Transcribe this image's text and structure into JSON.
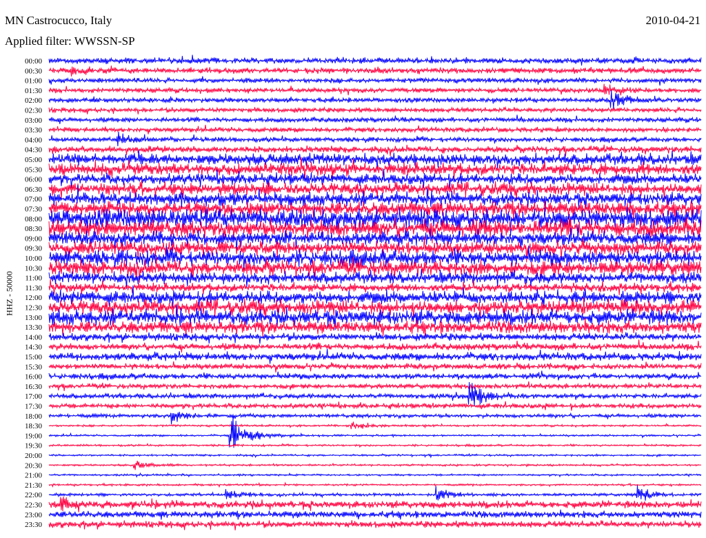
{
  "header": {
    "station": "MN Castrocucco, Italy",
    "date": "2010-04-21",
    "filter": "Applied filter: WWSSN-SP"
  },
  "chart_data": {
    "type": "line",
    "subtype": "helicorder",
    "title": "MN Castrocucco, Italy",
    "ylabel": "HHZ - 50000",
    "xlabel": "",
    "minutes_per_line": 30,
    "colors": [
      "#0000ff",
      "#ff0040"
    ],
    "rows": [
      {
        "t": "00:00",
        "noise": 0.6
      },
      {
        "t": "00:30",
        "noise": 0.6
      },
      {
        "t": "01:00",
        "noise": 0.5
      },
      {
        "t": "01:30",
        "noise": 0.5
      },
      {
        "t": "02:00",
        "noise": 0.5
      },
      {
        "t": "02:30",
        "noise": 0.5
      },
      {
        "t": "03:00",
        "noise": 0.5
      },
      {
        "t": "03:30",
        "noise": 0.5
      },
      {
        "t": "04:00",
        "noise": 0.5
      },
      {
        "t": "04:30",
        "noise": 0.7
      },
      {
        "t": "05:00",
        "noise": 1.2
      },
      {
        "t": "05:30",
        "noise": 1.3
      },
      {
        "t": "06:00",
        "noise": 1.1
      },
      {
        "t": "06:30",
        "noise": 1.3
      },
      {
        "t": "07:00",
        "noise": 1.4
      },
      {
        "t": "07:30",
        "noise": 1.5
      },
      {
        "t": "08:00",
        "noise": 2.0
      },
      {
        "t": "08:30",
        "noise": 1.8
      },
      {
        "t": "09:00",
        "noise": 1.4
      },
      {
        "t": "09:30",
        "noise": 1.4
      },
      {
        "t": "10:00",
        "noise": 1.6
      },
      {
        "t": "10:30",
        "noise": 1.6
      },
      {
        "t": "11:00",
        "noise": 1.2
      },
      {
        "t": "11:30",
        "noise": 0.9
      },
      {
        "t": "12:00",
        "noise": 1.3
      },
      {
        "t": "12:30",
        "noise": 1.5
      },
      {
        "t": "13:00",
        "noise": 1.6
      },
      {
        "t": "13:30",
        "noise": 1.3
      },
      {
        "t": "14:00",
        "noise": 0.8
      },
      {
        "t": "14:30",
        "noise": 0.7
      },
      {
        "t": "15:00",
        "noise": 0.8
      },
      {
        "t": "15:30",
        "noise": 0.6
      },
      {
        "t": "16:00",
        "noise": 0.6
      },
      {
        "t": "16:30",
        "noise": 0.5
      },
      {
        "t": "17:00",
        "noise": 0.5
      },
      {
        "t": "17:30",
        "noise": 0.5
      },
      {
        "t": "18:00",
        "noise": 0.4
      },
      {
        "t": "18:30",
        "noise": 0.2
      },
      {
        "t": "19:00",
        "noise": 0.2
      },
      {
        "t": "19:30",
        "noise": 0.2
      },
      {
        "t": "20:00",
        "noise": 0.2
      },
      {
        "t": "20:30",
        "noise": 0.2
      },
      {
        "t": "21:00",
        "noise": 0.2
      },
      {
        "t": "21:30",
        "noise": 0.2
      },
      {
        "t": "22:00",
        "noise": 0.3
      },
      {
        "t": "22:30",
        "noise": 0.8
      },
      {
        "t": "23:00",
        "noise": 0.7
      },
      {
        "t": "23:30",
        "noise": 0.7
      }
    ],
    "events": [
      {
        "row": 1,
        "minute": 1.1,
        "amp": 0.8
      },
      {
        "row": 3,
        "minute": 25.6,
        "amp": 1.2
      },
      {
        "row": 4,
        "minute": 25.9,
        "amp": 1.8
      },
      {
        "row": 8,
        "minute": 3.2,
        "amp": 1.5
      },
      {
        "row": 34,
        "minute": 19.4,
        "amp": 3.0
      },
      {
        "row": 36,
        "minute": 5.7,
        "amp": 1.0
      },
      {
        "row": 37,
        "minute": 14.0,
        "amp": 1.0
      },
      {
        "row": 38,
        "minute": 8.4,
        "amp": 5.0
      },
      {
        "row": 41,
        "minute": 4.0,
        "amp": 1.0
      },
      {
        "row": 44,
        "minute": 8.2,
        "amp": 1.3
      },
      {
        "row": 44,
        "minute": 17.8,
        "amp": 1.6
      },
      {
        "row": 44,
        "minute": 27.1,
        "amp": 1.6
      },
      {
        "row": 45,
        "minute": 0.6,
        "amp": 1.2
      }
    ]
  }
}
